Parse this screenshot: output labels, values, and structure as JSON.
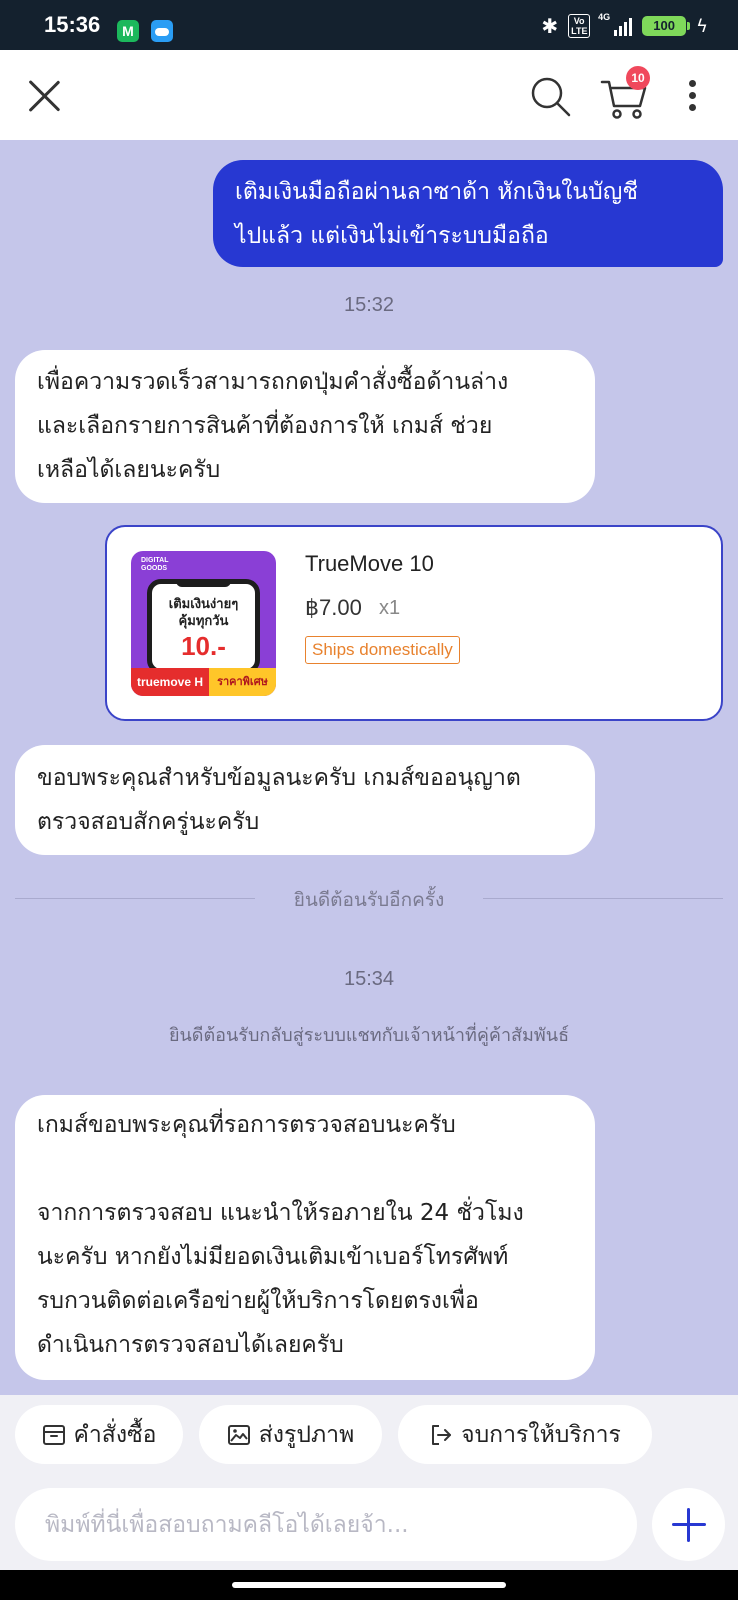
{
  "status_bar": {
    "time": "15:36",
    "app_icon_1_letter": "M",
    "bluetooth_icon": "bluetooth-icon",
    "volte_label": "Vo\nLTE",
    "network_label": "4G",
    "battery_level": "100"
  },
  "topbar": {
    "close_icon": "close-icon",
    "search_icon": "search-icon",
    "cart_icon": "cart-icon",
    "cart_badge": "10",
    "more_icon": "more-vertical-icon"
  },
  "chat": {
    "user_message": "เติมเงินมือถือผ่านลาซาด้า หักเงินในบัญชี\nไปแล้ว แต่เงินไม่เข้าระบบมือถือ",
    "time_1": "15:32",
    "agent_message_1": "เพื่อความรวดเร็วสามารถกดปุ่มคำสั่งซื้อด้านล่าง\nและเลือกรายการสินค้าที่ต้องการให้ เกมส์ ช่วย\nเหลือได้เลยนะครับ",
    "product": {
      "name": "TrueMove 10",
      "price": "฿7.00",
      "quantity": "x1",
      "tag": "Ships domestically",
      "image_headline": "เติมเงินง่ายๆ\nคุ้มทุกวัน",
      "image_price": "10.-",
      "image_brand": "truemove H",
      "image_promo": "ราคาพิเศษ",
      "image_badge": "DIGITAL\nGOODS"
    },
    "agent_message_2": "ขอบพระคุณสำหรับข้อมูลนะครับ เกมส์ขออนุญาต\nตรวจสอบสักครู่นะครับ",
    "divider_text": "ยินดีต้อนรับอีกครั้ง",
    "time_2": "15:34",
    "system_message": "ยินดีต้อนรับกลับสู่ระบบแชทกับเจ้าหน้าที่คู่ค้าสัมพันธ์",
    "agent_message_3": "เกมส์ขอบพระคุณที่รอการตรวจสอบนะครับ\n\nจากการตรวจสอบ แนะนำให้รอภายใน 24 ชั่วโมง\nนะครับ หากยังไม่มียอดเงินเติมเข้าเบอร์โทรศัพท์\nรบกวนติดต่อเครือข่ายผู้ให้บริการโดยตรงเพื่อ\nดำเนินการตรวจสอบได้เลยครับ"
  },
  "quick_actions": {
    "order_label": "คำสั่งซื้อ",
    "order_icon": "order-box-icon",
    "photo_label": "ส่งรูปภาพ",
    "photo_icon": "image-icon",
    "end_label": "จบการให้บริการ",
    "end_icon": "exit-icon"
  },
  "composer": {
    "placeholder": "พิมพ์ที่นี่เพื่อสอบถามคลีโอได้เลยจ้า...",
    "value": "",
    "plus_icon": "plus-icon"
  },
  "colors": {
    "chat_background": "#c5c6ea",
    "user_bubble": "#2738d2",
    "accent": "#2738d2",
    "badge": "#f0485c",
    "tag": "#e8822e"
  }
}
